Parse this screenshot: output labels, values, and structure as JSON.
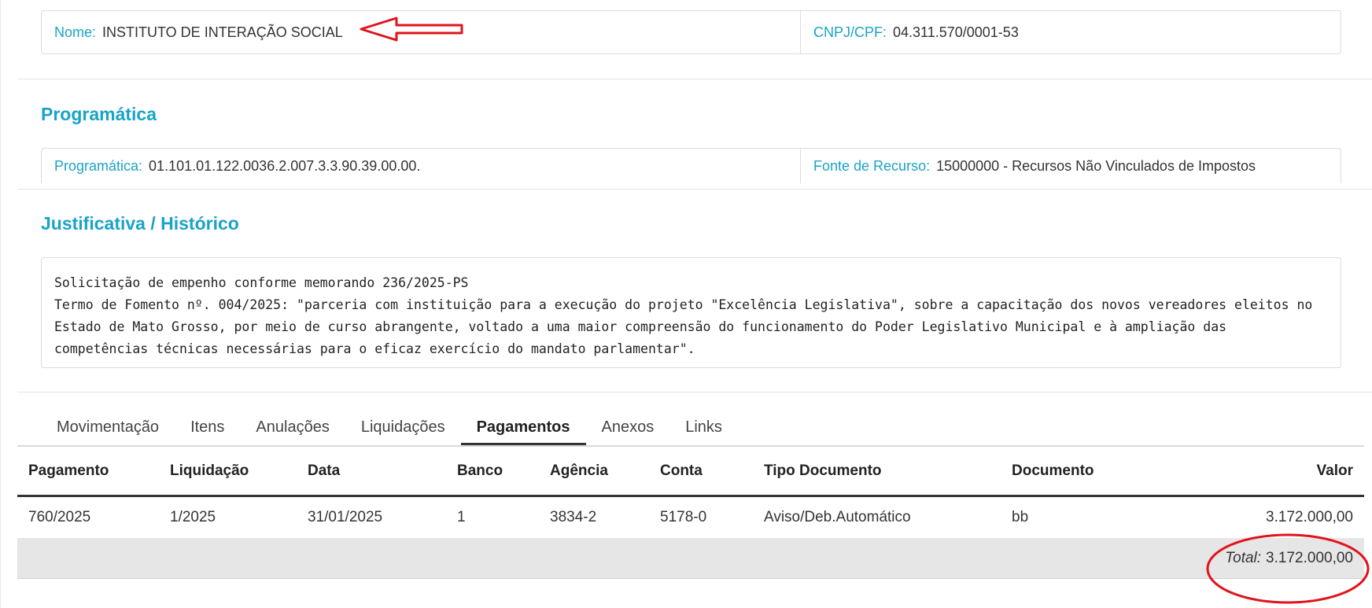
{
  "fornecedor": {
    "nome_label": "Nome:",
    "nome_value": "INSTITUTO DE INTERAÇÃO SOCIAL",
    "cnpj_label": "CNPJ/CPF:",
    "cnpj_value": "04.311.570/0001-53"
  },
  "programatica": {
    "title": "Programática",
    "prog_label": "Programática:",
    "prog_value": "01.101.01.122.0036.2.007.3.3.90.39.00.00.",
    "fonte_label": "Fonte de Recurso:",
    "fonte_value": "15000000 - Recursos Não Vinculados de Impostos"
  },
  "justificativa": {
    "title": "Justificativa / Histórico",
    "text": "Solicitação de empenho conforme memorando 236/2025-PS\nTermo de Fomento nº. 004/2025: \"parceria com instituição para a execução do projeto \"Excelência Legislativa\", sobre a capacitação dos novos vereadores eleitos no Estado de Mato Grosso, por meio de curso abrangente, voltado a uma maior compreensão do funcionamento do Poder Legislativo Municipal e à ampliação das competências técnicas necessárias para o eficaz exercício do mandato parlamentar\"."
  },
  "tabs": [
    {
      "label": "Movimentação"
    },
    {
      "label": "Itens"
    },
    {
      "label": "Anulações"
    },
    {
      "label": "Liquidações"
    },
    {
      "label": "Pagamentos"
    },
    {
      "label": "Anexos"
    },
    {
      "label": "Links"
    }
  ],
  "active_tab": "Pagamentos",
  "table": {
    "headers": [
      "Pagamento",
      "Liquidação",
      "Data",
      "Banco",
      "Agência",
      "Conta",
      "Tipo Documento",
      "Documento",
      "Valor"
    ],
    "rows": [
      [
        "760/2025",
        "1/2025",
        "31/01/2025",
        "1",
        "3834-2",
        "5178-0",
        "Aviso/Deb.Automático",
        "bb",
        "3.172.000,00"
      ]
    ],
    "total_label": "Total:",
    "total_value": "3.172.000,00"
  },
  "colors": {
    "accent": "#1aa3c7",
    "annotation": "#e0141e"
  }
}
